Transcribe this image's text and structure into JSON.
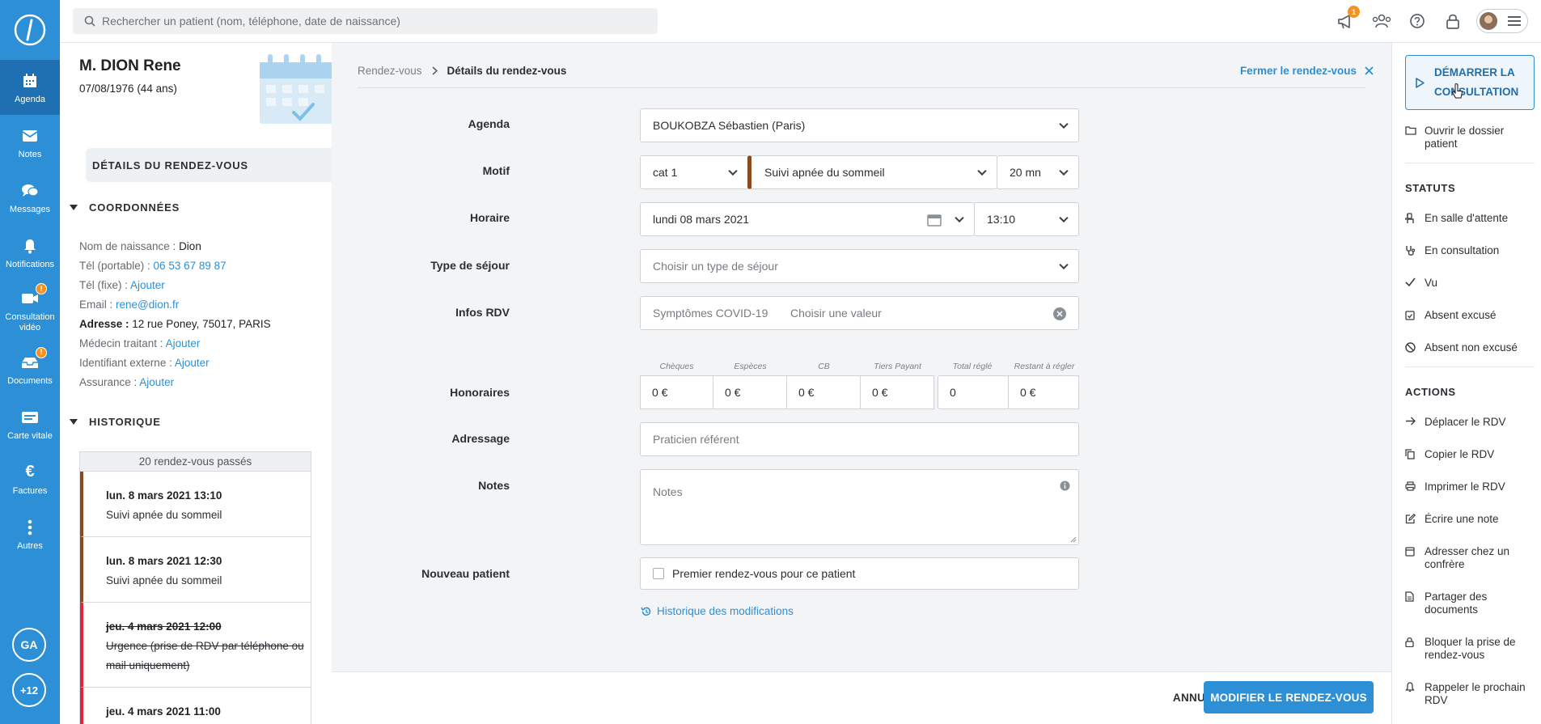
{
  "nav": {
    "items": [
      {
        "label": "Agenda",
        "icon": "calendar-icon"
      },
      {
        "label": "Notes",
        "icon": "mail-icon"
      },
      {
        "label": "Messages",
        "icon": "chat-icon"
      },
      {
        "label": "Notifications",
        "icon": "bell-icon"
      },
      {
        "label": "Consultation vidéo",
        "icon": "video-icon",
        "badge": "!"
      },
      {
        "label": "Documents",
        "icon": "tray-icon",
        "badge": "!"
      },
      {
        "label": "Carte vitale",
        "icon": "card-icon"
      },
      {
        "label": "Factures",
        "icon": "euro-icon"
      },
      {
        "label": "Autres",
        "icon": "dots-icon"
      }
    ],
    "user_initials": "GA",
    "more_count": "+12"
  },
  "topbar": {
    "search_placeholder": "Rechercher un patient (nom, téléphone, date de naissance)",
    "announcement_badge": "1"
  },
  "patient": {
    "name": "M. DION Rene",
    "dob": "07/08/1976 (44 ans)",
    "details_tab": "DÉTAILS DU RENDEZ-VOUS",
    "coord_title": "COORDONNÉES",
    "coord": {
      "birth_name_label": "Nom de naissance : ",
      "birth_name": "Dion",
      "mobile_label": "Tél (portable) : ",
      "mobile": "06 53 67 89 87",
      "fixed_label": "Tél (fixe) : ",
      "fixed": "Ajouter",
      "email_label": "Email : ",
      "email": "rene@dion.fr",
      "address_label": "Adresse : ",
      "address": "12 rue Poney, 75017, PARIS",
      "doctor_label": "Médecin traitant : ",
      "doctor": "Ajouter",
      "extid_label": "Identifiant externe : ",
      "extid": "Ajouter",
      "insurance_label": "Assurance : ",
      "insurance": "Ajouter"
    },
    "history_title": "HISTORIQUE",
    "history_count": "20 rendez-vous passés",
    "history": [
      {
        "date": "lun. 8 mars 2021 13:10",
        "motif": "Suivi apnée du sommeil"
      },
      {
        "date": "lun. 8 mars 2021 12:30",
        "motif": "Suivi apnée du sommeil"
      },
      {
        "date": "jeu. 4 mars 2021 12:00",
        "motif": "Urgence (prise de RDV par téléphone ou mail uniquement)"
      },
      {
        "date": "jeu. 4 mars 2021 11:00",
        "motif": ""
      }
    ]
  },
  "main": {
    "breadcrumb_root": "Rendez-vous",
    "breadcrumb_current": "Détails du rendez-vous",
    "close_label": "Fermer le rendez-vous",
    "labels": {
      "agenda": "Agenda",
      "motif": "Motif",
      "horaire": "Horaire",
      "sejour": "Type de séjour",
      "infos": "Infos RDV",
      "honoraires": "Honoraires",
      "adressage": "Adressage",
      "notes": "Notes",
      "nouveau": "Nouveau patient"
    },
    "agenda_value": "BOUKOBZA  Sébastien (Paris)",
    "motif_cat": "cat 1",
    "motif_value": "Suivi apnée du sommeil",
    "motif_color": "#8a4a1c",
    "duration": "20 mn",
    "date": "lundi 08 mars 2021",
    "time": "13:10",
    "sejour_placeholder": "Choisir un type de séjour",
    "infos_label": "Symptômes COVID-19",
    "infos_placeholder": "Choisir une valeur",
    "honoraires": [
      {
        "label": "Chèques",
        "value": "0 €"
      },
      {
        "label": "Espèces",
        "value": "0 €"
      },
      {
        "label": "CB",
        "value": "0 €"
      },
      {
        "label": "Tiers Payant",
        "value": "0 €"
      },
      {
        "label": "Total réglé",
        "value": "0"
      },
      {
        "label": "Restant à régler",
        "value": "0 €"
      }
    ],
    "adressage_placeholder": "Praticien référent",
    "notes_placeholder": "Notes",
    "new_patient_label": "Premier rendez-vous pour ce patient",
    "history_link": "Historique des modifications",
    "cancel": "ANNULER",
    "submit": "MODIFIER LE RENDEZ-VOUS"
  },
  "side": {
    "start": "DÉMARRER LA CONSULTATION",
    "open_file": "Ouvrir le dossier patient",
    "statuts_title": "STATUTS",
    "statuts": [
      "En salle d'attente",
      "En consultation",
      "Vu",
      "Absent excusé",
      "Absent non excusé"
    ],
    "actions_title": "ACTIONS",
    "actions": [
      "Déplacer le RDV",
      "Copier le RDV",
      "Imprimer le RDV",
      "Écrire une note",
      "Adresser chez un confrère",
      "Partager des documents",
      "Bloquer la prise de rendez-vous",
      "Rappeler le prochain RDV"
    ]
  },
  "colors": {
    "accent": "#2d8fd5",
    "nav_active": "#1e70b3",
    "badge": "#f39322",
    "cancelled": "#e2233a"
  }
}
